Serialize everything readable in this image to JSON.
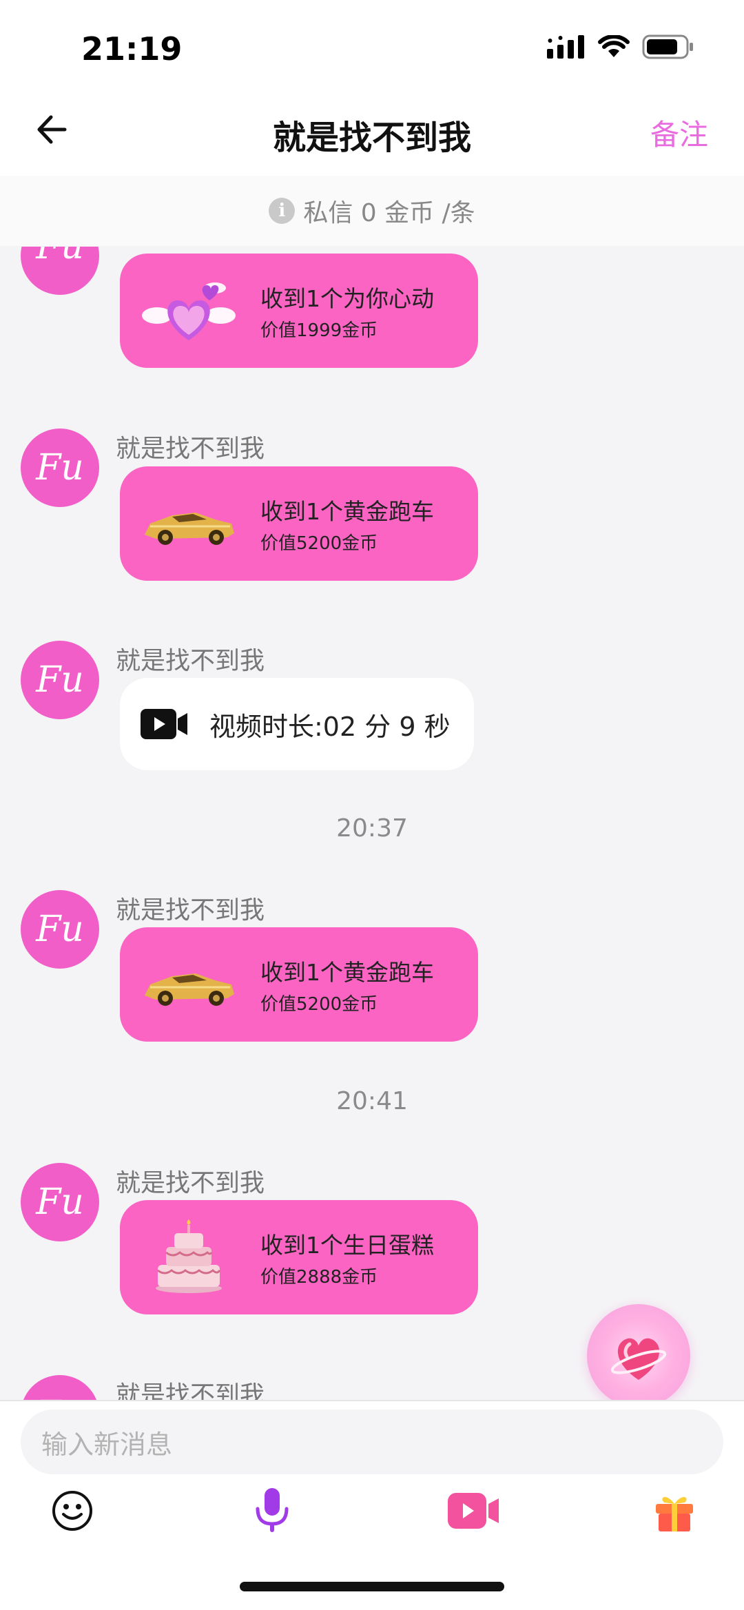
{
  "status_bar": {
    "time": "21:19"
  },
  "header": {
    "title": "就是找不到我",
    "remark_label": "备注"
  },
  "notice": {
    "text": "私信 0 金币 /条"
  },
  "messages": [
    {
      "sender": "",
      "avatar": "Fu",
      "gift_title": "收到1个为你心动",
      "gift_value": "价值1999金币",
      "icon": "heart-wings-gift-icon"
    },
    {
      "sender": "就是找不到我",
      "avatar": "Fu",
      "gift_title": "收到1个黄金跑车",
      "gift_value": "价值5200金币",
      "icon": "gold-car-gift-icon"
    },
    {
      "sender": "就是找不到我",
      "avatar": "Fu",
      "video_text": "视频时长:02 分 9 秒",
      "icon": "video-camera-icon"
    },
    {
      "timestamp": "20:37"
    },
    {
      "sender": "就是找不到我",
      "avatar": "Fu",
      "gift_title": "收到1个黄金跑车",
      "gift_value": "价值5200金币",
      "icon": "gold-car-gift-icon"
    },
    {
      "timestamp": "20:41"
    },
    {
      "sender": "就是找不到我",
      "avatar": "Fu",
      "gift_title": "收到1个生日蛋糕",
      "gift_value": "价值2888金币",
      "icon": "birthday-cake-gift-icon"
    },
    {
      "sender": "就是找不到我",
      "avatar": "Fu"
    }
  ],
  "input": {
    "placeholder": "输入新消息"
  },
  "toolbar": {
    "icons": [
      "emoji-icon",
      "microphone-icon",
      "video-call-icon",
      "gift-icon"
    ]
  },
  "colors": {
    "accent": "#fb64c2",
    "avatar": "#f25ec8",
    "remark": "#e86be0"
  }
}
